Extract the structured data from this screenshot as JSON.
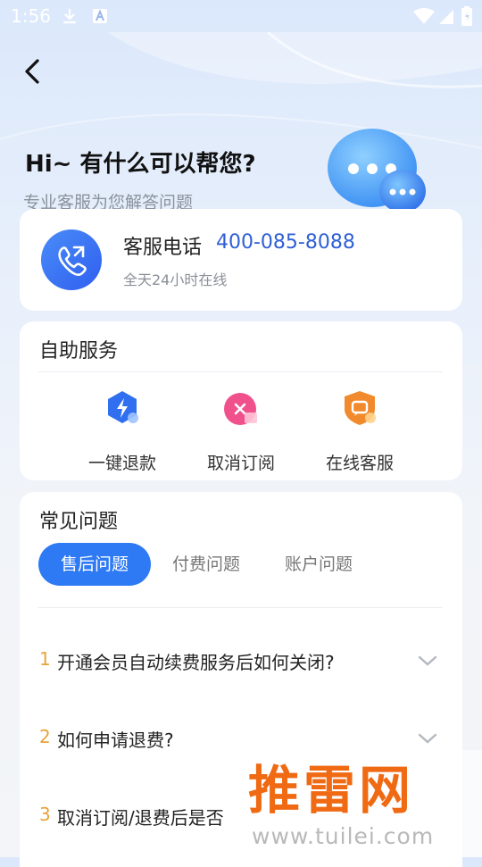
{
  "status_bar": {
    "time": "1:56"
  },
  "header": {
    "title": "Hi~ 有什么可以帮您?",
    "subtitle": "专业客服为您解答问题"
  },
  "hotline": {
    "label": "客服电话",
    "number": "400-085-8088",
    "hours": "全天24小时在线"
  },
  "self_service": {
    "title": "自助服务",
    "items": [
      {
        "label": "一键退款",
        "icon": "lightning-refund-icon",
        "color": "#2f6ff0"
      },
      {
        "label": "取消订阅",
        "icon": "cancel-subscription-icon",
        "color": "#f0508c"
      },
      {
        "label": "在线客服",
        "icon": "chat-support-icon",
        "color": "#f08a2c"
      }
    ]
  },
  "faq": {
    "title": "常见问题",
    "tabs": [
      {
        "label": "售后问题",
        "active": true
      },
      {
        "label": "付费问题",
        "active": false
      },
      {
        "label": "账户问题",
        "active": false
      }
    ],
    "questions": [
      {
        "num": "1",
        "text": "开通会员自动续费服务后如何关闭?"
      },
      {
        "num": "2",
        "text": "如何申请退费?"
      },
      {
        "num": "3",
        "text": "取消订阅/退费后是否"
      }
    ]
  },
  "watermark": {
    "brand": "推雷网",
    "url": "www.tuilei.com"
  }
}
